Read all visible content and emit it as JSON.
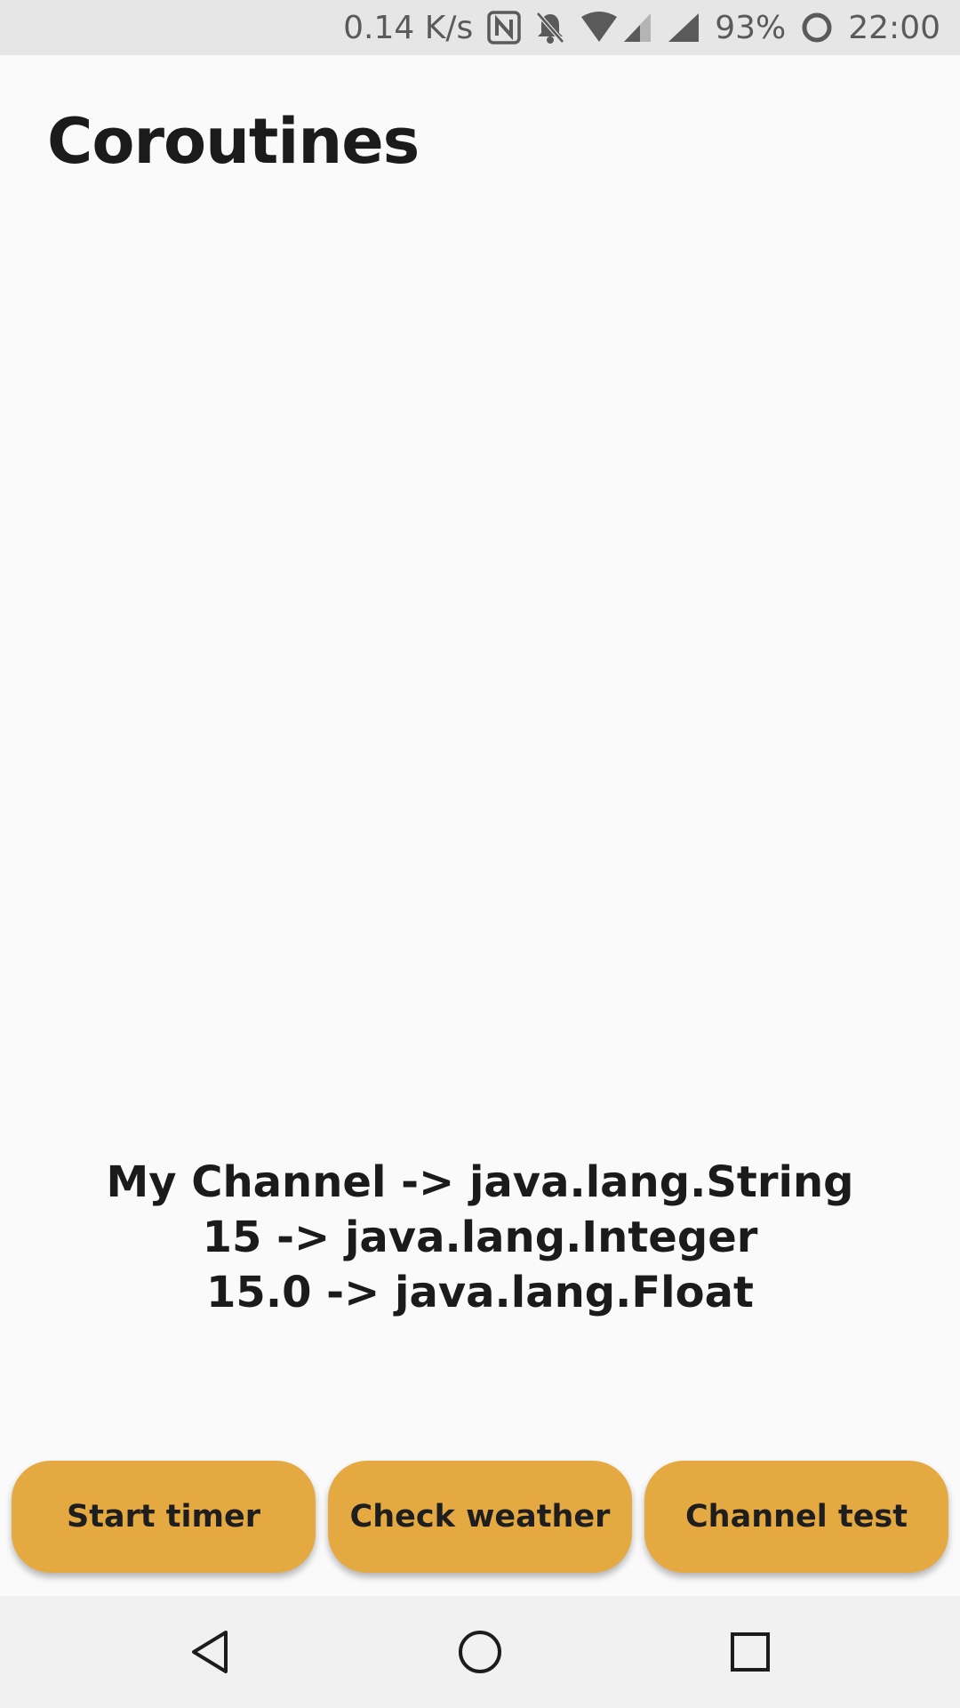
{
  "status_bar": {
    "network_speed": "0.14 K/s",
    "battery": "93%",
    "time": "22:00",
    "icons": [
      "nfc-icon",
      "bell-off-icon",
      "wifi-icon",
      "signal-icon",
      "signal-icon",
      "battery-saver-ring-icon"
    ]
  },
  "header": {
    "title": "Coroutines"
  },
  "output": {
    "lines": [
      "My Channel -> java.lang.String",
      "15 -> java.lang.Integer",
      "15.0 -> java.lang.Float"
    ]
  },
  "buttons": {
    "start_timer": "Start timer",
    "check_weather": "Check weather",
    "channel_test": "Channel test"
  },
  "nav_bar": {
    "icons": [
      "back-icon",
      "home-icon",
      "recents-icon"
    ]
  },
  "colors": {
    "button_background": "#e5a942",
    "page_background": "#fafafa",
    "status_bar_background": "#e6e6e6",
    "nav_bar_background": "#f1f1f1",
    "text": "#1b1b1b"
  }
}
